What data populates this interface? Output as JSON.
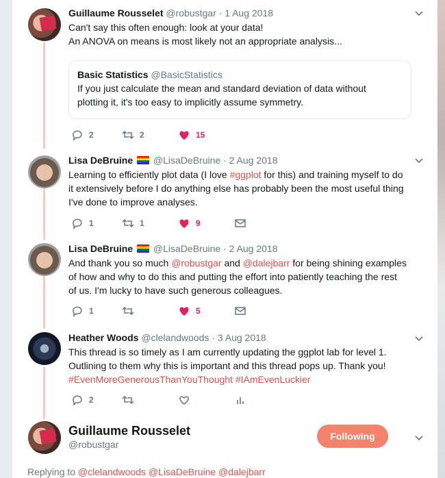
{
  "tweets": [
    {
      "name": "Guillaume Rousselet",
      "handle": "@robustgar",
      "sep": "·",
      "date": "1 Aug 2018",
      "lines": [
        "Can't say this often enough: look at your data!",
        "An ANOVA on means is most likely not an appropriate analysis..."
      ],
      "quote": {
        "name": "Basic Statistics",
        "handle": "@BasicStatistics",
        "lines": [
          "If you just calculate the mean and standard deviation of data without",
          "plotting it, it's too easy to implicitly assume symmetry."
        ]
      },
      "replies": "2",
      "retweets": "2",
      "likes": "15"
    },
    {
      "name": "Lisa DeBruine",
      "handle": "@LisaDeBruine",
      "sep": "·",
      "date": "2 Aug 2018",
      "line1_a": "Learning to efficiently plot data (I love ",
      "line1_tag": "#ggplot",
      "line1_b": " for this) and training myself to do",
      "line2": "it extensively before I do anything else has probably been the most useful thing",
      "line3": "I've done to improve analyses.",
      "replies": "1",
      "retweets": "1",
      "likes": "9"
    },
    {
      "name": "Lisa DeBruine",
      "handle": "@LisaDeBruine",
      "sep": "·",
      "date": "2 Aug 2018",
      "line1_a": "And thank you so much ",
      "line1_m1": "@robustgar",
      "line1_b": " and ",
      "line1_m2": "@dalejbarr",
      "line1_c": " for being shining examples",
      "line2": "of how and why to do this and putting the effort into patiently teaching the rest",
      "line3": "of us. I'm lucky to have such generous colleagues.",
      "replies": "1",
      "likes": "5"
    },
    {
      "name": "Heather Woods",
      "handle": "@clelandwoods",
      "sep": "·",
      "date": "3 Aug 2018",
      "line1": "This thread is so timely as I am currently updating the ggplot lab for level 1.",
      "line2": "Outlining to them why this is important and this thread pops up. Thank you!",
      "tag1": "#EvenMoreGenerousThanYouThought",
      "tag2": "#IAmEvenLuckier",
      "replies": "2"
    }
  ],
  "focused": {
    "name": "Guillaume Rousselet",
    "handle": "@robustgar",
    "follow_label": "Following",
    "replying_prefix": "Replying to",
    "replying_to": [
      "@clelandwoods",
      "@LisaDeBruine",
      "@dalejbarr"
    ]
  },
  "colors": {
    "accent": "#e0524a",
    "like": "#e0245e",
    "follow_bg": "#f5836c",
    "thread": "#f9c9c5"
  },
  "icons": [
    "reply-icon",
    "retweet-icon",
    "heart-icon",
    "mail-icon",
    "chevron-down-icon",
    "analytics-icon"
  ]
}
